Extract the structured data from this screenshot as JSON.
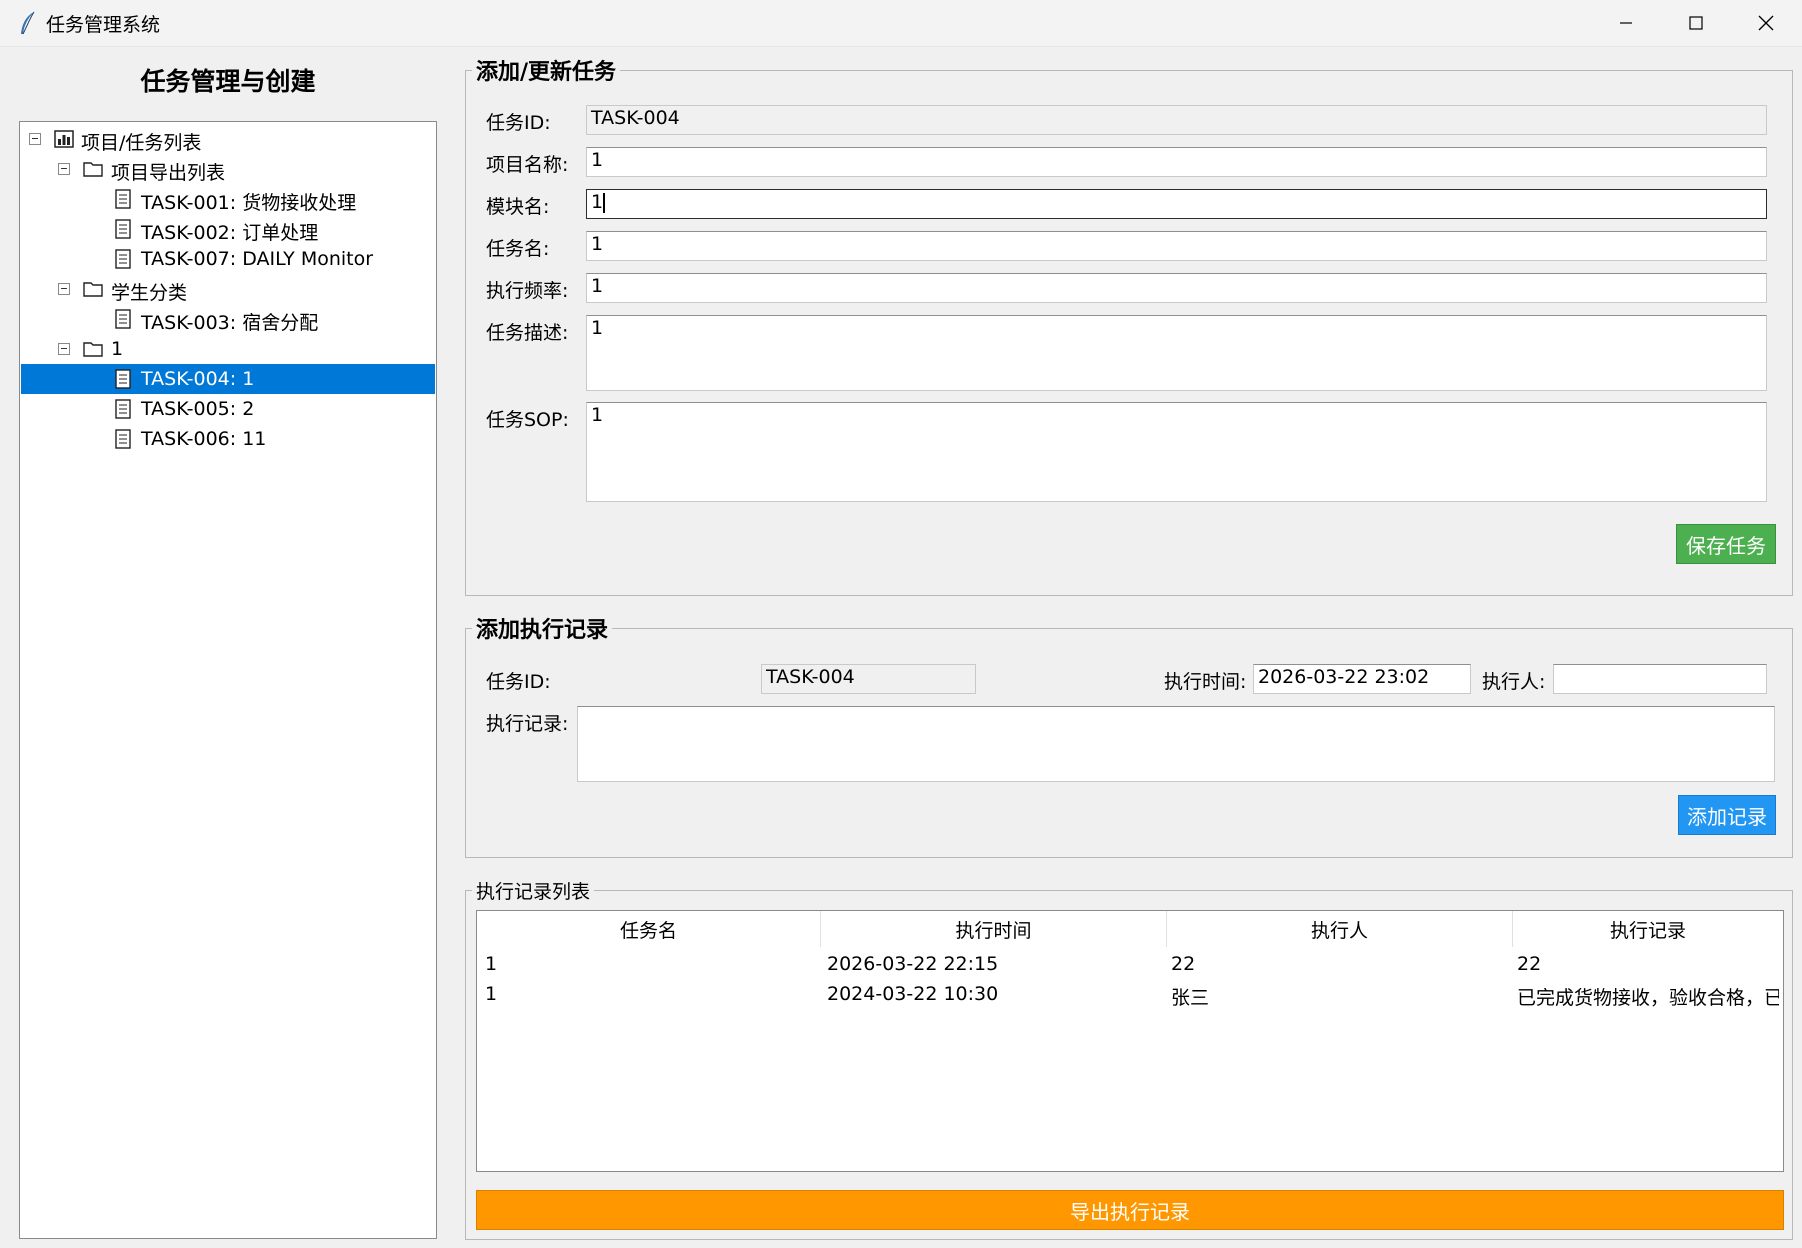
{
  "window": {
    "title": "任务管理系统"
  },
  "left": {
    "title": "任务管理与创建",
    "tree": {
      "root": "项目/任务列表",
      "groups": [
        {
          "label": "项目导出列表",
          "tasks": [
            "TASK-001: 货物接收处理",
            "TASK-002: 订单处理",
            "TASK-007: DAILY Monitor"
          ]
        },
        {
          "label": "学生分类",
          "tasks": [
            "TASK-003: 宿舍分配"
          ]
        },
        {
          "label": "1",
          "tasks": [
            "TASK-004: 1",
            "TASK-005: 2",
            "TASK-006: 11"
          ]
        }
      ],
      "selected": "TASK-004: 1"
    }
  },
  "task_form": {
    "title": "添加/更新任务",
    "task_id_label": "任务ID:",
    "task_id": "TASK-004",
    "project_label": "项目名称:",
    "project": "1",
    "module_label": "模块名:",
    "module": "1",
    "task_name_label": "任务名:",
    "task_name": "1",
    "frequency_label": "执行频率:",
    "frequency": "1",
    "description_label": "任务描述:",
    "description": "1",
    "sop_label": "任务SOP:",
    "sop": "1",
    "save_button": "保存任务",
    "save_color": "#4caf50"
  },
  "record_form": {
    "title": "添加执行记录",
    "task_id_label": "任务ID:",
    "task_id": "TASK-004",
    "time_label": "执行时间:",
    "time": "2026-03-22 23:02",
    "executor_label": "执行人:",
    "executor": "",
    "record_label": "执行记录:",
    "record": "",
    "add_button": "添加记录",
    "add_color": "#2196f3"
  },
  "records": {
    "title": "执行记录列表",
    "columns": [
      "任务名",
      "执行时间",
      "执行人",
      "执行记录"
    ],
    "rows": [
      [
        "1",
        "2026-03-22 22:15",
        "22",
        "22"
      ],
      [
        "1",
        "2024-03-22 10:30",
        "张三",
        "已完成货物接收，验收合格，已登记入库"
      ]
    ],
    "export_button": "导出执行记录",
    "export_color": "#ff9800",
    "selected_color": "#0078d7"
  }
}
